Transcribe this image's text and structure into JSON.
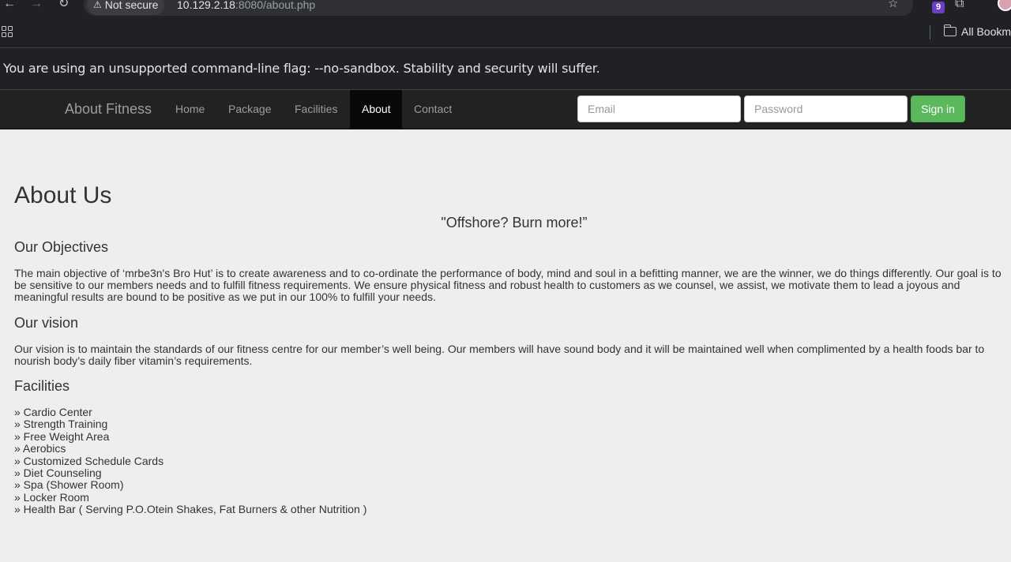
{
  "browser": {
    "security_label": "Not secure",
    "url_host": "10.129.2.18",
    "url_rest": ":8080/about.php",
    "extension_badge": "9",
    "bookmarks_folder": "All Bookmarks",
    "infobar_message": "You are using an unsupported command-line flag: --no-sandbox. Stability and security will suffer."
  },
  "navbar": {
    "brand": "About Fitness",
    "links": [
      "Home",
      "Package",
      "Facilities",
      "About",
      "Contact"
    ],
    "active": "About",
    "email_placeholder": "Email",
    "password_placeholder": "Password",
    "signin_label": "Sign in",
    "signin_color": "#5cb85c"
  },
  "content": {
    "title": "About Us",
    "slogan": "\"Offshore? Burn more!”",
    "objectives_heading": "Our Objectives",
    "objectives_text": "The main objective of ‘mrbe3n's Bro Hut’ is to create awareness and to co-ordinate the performance of body, mind and soul in a befitting manner, we are the winner, we do things differently. Our goal is to be sensitive to our members needs and to fulfill fitness requirements. We ensure physical fitness and robust health to customers as we counsel, we assist, we motivate them to lead a joyous and meaningful results are bound to be positive as we put in our 100% to fulfill your needs.",
    "vision_heading": "Our vision",
    "vision_text": "Our vision is to maintain the standards of our fitness centre for our member’s well being. Our members will have sound body and it will be maintained well when complimented by a health foods bar to nourish body’s daily fiber vitamin’s requirements.",
    "facilities_heading": "Facilities",
    "facilities": [
      "» Cardio Center",
      "» Strength Training",
      "» Free Weight Area",
      "» Aerobics",
      "» Customized Schedule Cards",
      "» Diet Counseling",
      "» Spa (Shower Room)",
      "» Locker Room",
      "» Health Bar ( Serving P.O.Otein Shakes, Fat Burners & other Nutrition )"
    ]
  }
}
